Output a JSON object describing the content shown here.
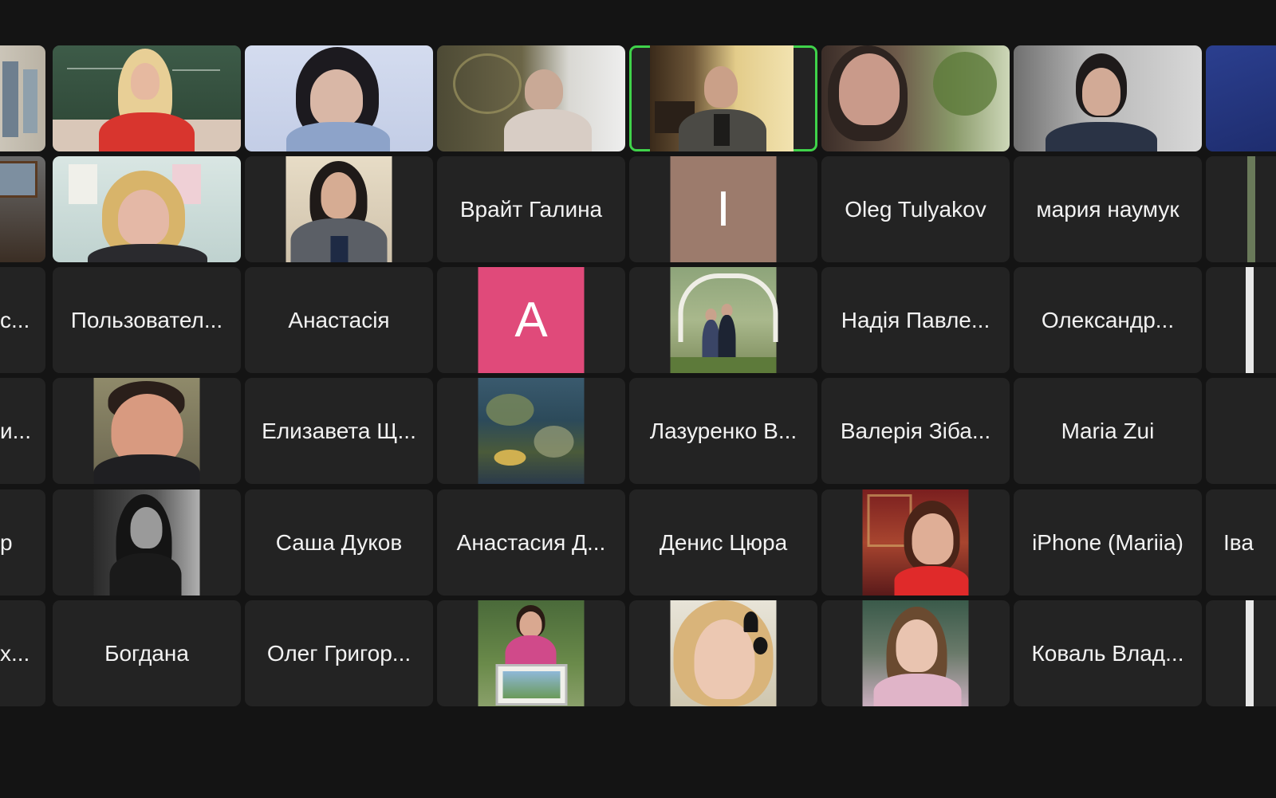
{
  "colors": {
    "background": "#141414",
    "tile": "#232323",
    "active_speaker_border": "#3fd24a",
    "avatar_I": "#9c7b6c",
    "avatar_A": "#e04a7a"
  },
  "participants": {
    "row2": {
      "c3": "Врайт Галина",
      "c4_avatar_letter": "I",
      "c5": "Oleg Tulyakov",
      "c6": "мария наумук"
    },
    "row3": {
      "c0": "с...",
      "c1": "Пользовател...",
      "c2": "Анастасія",
      "c3_avatar_letter": "A",
      "c5": "Надія Павле...",
      "c6": "Олександр..."
    },
    "row4": {
      "c0": "и...",
      "c2": "Елизавета Щ...",
      "c4": "Лазуренко В...",
      "c5": "Валерія Зіба...",
      "c6": "Maria Zui"
    },
    "row5": {
      "c0": "р",
      "c2": "Саша Дуков",
      "c3": "Анастасия Д...",
      "c4": "Денис Цюра",
      "c6": "iPhone (Mariia)",
      "c7": "Іва"
    },
    "row6": {
      "c0": "х...",
      "c1": "Богдана",
      "c2": "Олег Григор...",
      "c6": "Коваль Влад..."
    }
  }
}
